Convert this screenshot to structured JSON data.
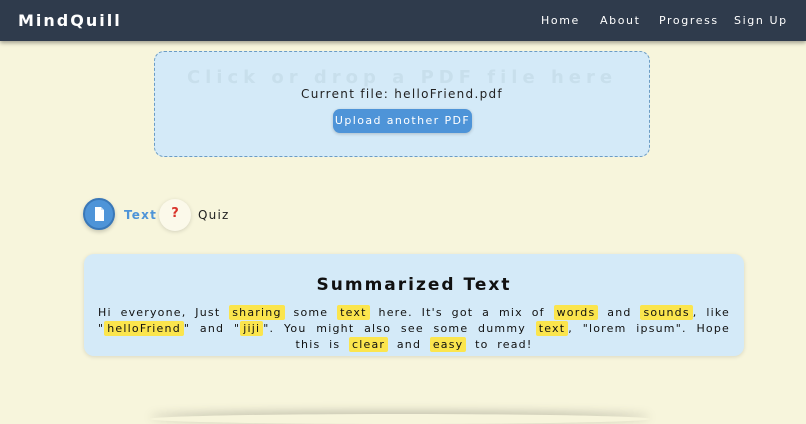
{
  "nav": {
    "logo": "MindQuill",
    "links": [
      "Home",
      "About",
      "Progress",
      "Sign Up"
    ]
  },
  "upload": {
    "prompt": "Click or drop a PDF file here",
    "current_file": "Current file: helloFriend.pdf",
    "button_label": "Upload another PDF"
  },
  "tabs": {
    "text_label": "Text",
    "quiz_label": "Quiz",
    "quiz_symbol": "?"
  },
  "summary": {
    "title": "Summarized Text",
    "segments": [
      {
        "text": "Hi everyone, Just ",
        "hl": false
      },
      {
        "text": "sharing",
        "hl": true
      },
      {
        "text": " some ",
        "hl": false
      },
      {
        "text": "text",
        "hl": true
      },
      {
        "text": " here. It's got a mix of ",
        "hl": false
      },
      {
        "text": "words",
        "hl": true
      },
      {
        "text": " and ",
        "hl": false
      },
      {
        "text": "sounds",
        "hl": true
      },
      {
        "text": ", like \"",
        "hl": false
      },
      {
        "text": "helloFriend",
        "hl": true
      },
      {
        "text": "\" and \"",
        "hl": false
      },
      {
        "text": "jiji",
        "hl": true
      },
      {
        "text": "\". You might also see some dummy ",
        "hl": false
      },
      {
        "text": "text",
        "hl": true
      },
      {
        "text": ", \"lorem ipsum\". Hope this is ",
        "hl": false
      },
      {
        "text": "clear",
        "hl": true
      },
      {
        "text": " and ",
        "hl": false
      },
      {
        "text": "easy",
        "hl": true
      },
      {
        "text": " to read!",
        "hl": false
      }
    ]
  },
  "colors": {
    "nav_bg": "#2f3b4c",
    "page_bg": "#f7f5dc",
    "accent": "#4e94d8",
    "card_bg": "#d4eaf8",
    "highlight": "#fbe54d",
    "quiz_icon": "#d9342b"
  }
}
